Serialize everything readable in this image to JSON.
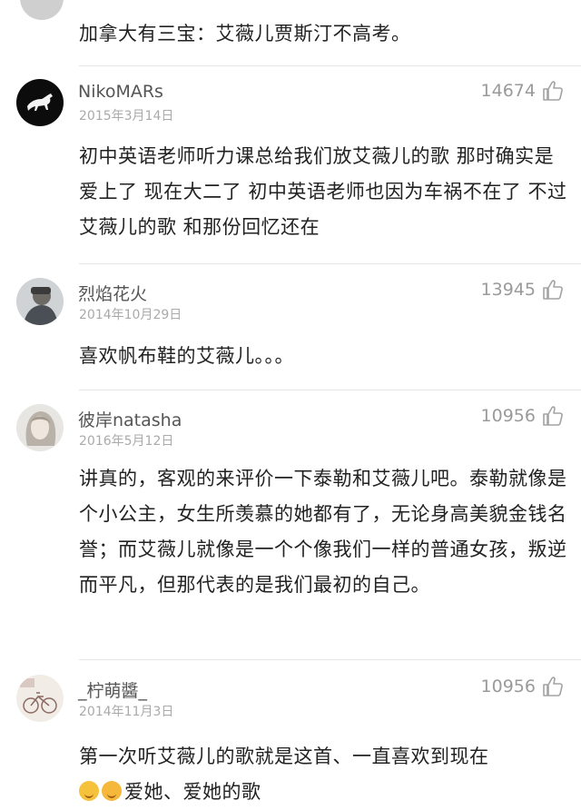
{
  "top_comment": {
    "text": "加拿大有三宝：艾薇儿贾斯汀不高考。"
  },
  "comments": [
    {
      "username": "NikoMARs",
      "date": "2015年3月14日",
      "likes": "14674",
      "text": "初中英语老师听力课总给我们放艾薇儿的歌 那时确实是爱上了 现在大二了 初中英语老师也因为车祸不在了 不过艾薇儿的歌 和那份回忆还在"
    },
    {
      "username": "烈焰花火",
      "date": "2014年10月29日",
      "likes": "13945",
      "text": "喜欢帆布鞋的艾薇儿。。。"
    },
    {
      "username": "彼岸natasha",
      "date": "2016年5月12日",
      "likes": "10956",
      "text": "讲真的，客观的来评价一下泰勒和艾薇儿吧。泰勒就像是个小公主，女生所羡慕的她都有了，无论身高美貌金钱名誉；而艾薇儿就像是一个个像我们一样的普通女孩，叛逆而平凡，但那代表的是我们最初的自己。"
    },
    {
      "username": "_柠萌醬_",
      "date": "2014年11月3日",
      "likes": "10956",
      "text_line1": "第一次听艾薇儿的歌就是这首、一直喜欢到现在",
      "text_line2": "爱她、爱她的歌",
      "emojis": [
        "smiling-face-emoji",
        "kissing-face-emoji"
      ]
    }
  ],
  "icons": {
    "like": "thumbs-up-icon"
  }
}
